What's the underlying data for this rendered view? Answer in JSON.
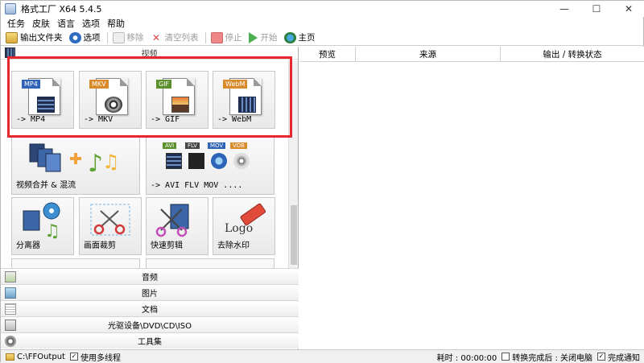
{
  "window": {
    "title": "格式工厂 X64 5.4.5",
    "minimize": "—",
    "maximize": "☐",
    "close": "✕"
  },
  "menu": [
    "任务",
    "皮肤",
    "语言",
    "选项",
    "帮助"
  ],
  "toolbar": {
    "output_folder": "输出文件夹",
    "options": "选项",
    "remove": "移除",
    "clear_list": "清空列表",
    "stop": "停止",
    "start": "开始",
    "home": "主页"
  },
  "left": {
    "video_header": "视频",
    "tiles": {
      "mp4": {
        "tag": "MP4",
        "label": "-> MP4"
      },
      "mkv": {
        "tag": "MKV",
        "label": "-> MKV"
      },
      "gif": {
        "tag": "GIF",
        "label": "-> GIF"
      },
      "webm": {
        "tag": "WebM",
        "label": "-> WebM"
      },
      "merge": {
        "label": "视频合并 & 混流"
      },
      "multi": {
        "label": "-> AVI FLV MOV ....",
        "tags": [
          "AVI",
          "FLV",
          "MOV",
          "VOB"
        ]
      },
      "splitter": {
        "label": "分离器"
      },
      "crop": {
        "label": "画面裁剪"
      },
      "quick_cut": {
        "label": "快速剪辑"
      },
      "remove_watermark": {
        "label": "去除水印",
        "logo_text": "Logo"
      }
    },
    "categories": [
      "音频",
      "图片",
      "文档",
      "光驱设备\\DVD\\CD\\ISO",
      "工具集"
    ]
  },
  "right": {
    "columns": [
      "预览",
      "来源",
      "输出 / 转换状态"
    ]
  },
  "status": {
    "output_path": "C:\\FFOutput",
    "multithread_label": "使用多线程",
    "elapsed": "耗时 : 00:00:00",
    "after_convert": "转换完成后 : 关闭电脑",
    "notify": "完成通知",
    "check_mark": "✓"
  },
  "colors": {
    "highlight": "#e5272e",
    "window_bg": "#ffffff"
  }
}
